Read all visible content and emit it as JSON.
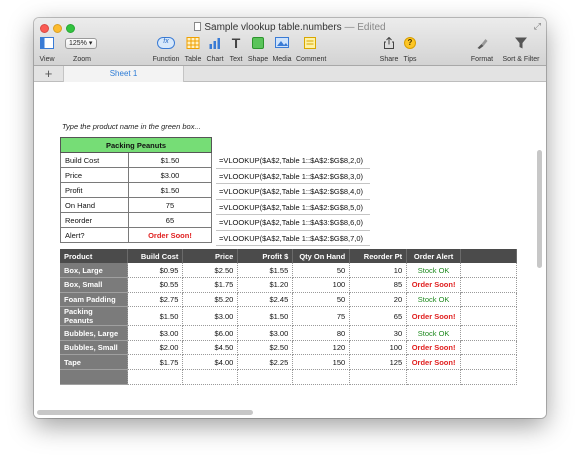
{
  "window": {
    "title": "Sample vlookup table.numbers",
    "status": "— Edited"
  },
  "toolbar": {
    "zoom_value": "125%",
    "items": [
      {
        "label": "View",
        "icon": "view-icon"
      },
      {
        "label": "Zoom",
        "icon": "zoom-select"
      },
      {
        "label": "Function",
        "icon": "function-icon"
      },
      {
        "label": "Table",
        "icon": "table-icon"
      },
      {
        "label": "Chart",
        "icon": "chart-icon"
      },
      {
        "label": "Text",
        "icon": "text-icon"
      },
      {
        "label": "Shape",
        "icon": "shape-icon"
      },
      {
        "label": "Media",
        "icon": "media-icon"
      },
      {
        "label": "Comment",
        "icon": "comment-icon"
      },
      {
        "label": "Share",
        "icon": "share-icon"
      },
      {
        "label": "Tips",
        "icon": "tips-icon"
      },
      {
        "label": "Format",
        "icon": "format-icon"
      },
      {
        "label": "Sort & Filter",
        "icon": "sort-filter-icon"
      }
    ],
    "function_glyph": "fx",
    "tips_glyph": "?",
    "text_glyph": "T"
  },
  "sheets": {
    "add_glyph": "+",
    "active": "Sheet 1"
  },
  "instruction": "Type the product name in the green box...",
  "lookup_table": {
    "header": "Packing Peanuts",
    "rows": [
      {
        "label": "Build Cost",
        "value": "$1.50",
        "formula": "=VLOOKUP($A$2,Table 1::$A$2:$G$8,2,0)"
      },
      {
        "label": "Price",
        "value": "$3.00",
        "formula": "=VLOOKUP($A$2,Table 1::$A$2:$G$8,3,0)"
      },
      {
        "label": "Profit",
        "value": "$1.50",
        "formula": "=VLOOKUP($A$2,Table 1::$A$2:$G$8,4,0)"
      },
      {
        "label": "On Hand",
        "value": "75",
        "formula": "=VLOOKUP($A$2,Table 1::$A$2:$G$8,5,0)"
      },
      {
        "label": "Reorder",
        "value": "65",
        "formula": "=VLOOKUP($A$2,Table 1::$A$3:$G$8,6,0)"
      },
      {
        "label": "Alert?",
        "value": "Order Soon!",
        "formula": "=VLOOKUP($A$2,Table 1::$A$2:$G$8,7,0)"
      }
    ]
  },
  "products_table": {
    "headers": [
      "Product",
      "Build Cost",
      "Price",
      "Profit $",
      "Qty On Hand",
      "Reorder Pt",
      "Order Alert"
    ],
    "rows": [
      {
        "product": "Box, Large",
        "build": "$0.95",
        "price": "$2.50",
        "profit": "$1.55",
        "qty": "50",
        "reorder": "10",
        "alert": "Stock OK"
      },
      {
        "product": "Box, Small",
        "build": "$0.55",
        "price": "$1.75",
        "profit": "$1.20",
        "qty": "100",
        "reorder": "85",
        "alert": "Order Soon!"
      },
      {
        "product": "Foam Padding",
        "build": "$2.75",
        "price": "$5.20",
        "profit": "$2.45",
        "qty": "50",
        "reorder": "20",
        "alert": "Stock OK"
      },
      {
        "product": "Packing Peanuts",
        "build": "$1.50",
        "price": "$3.00",
        "profit": "$1.50",
        "qty": "75",
        "reorder": "65",
        "alert": "Order Soon!"
      },
      {
        "product": "Bubbles, Large",
        "build": "$3.00",
        "price": "$6.00",
        "profit": "$3.00",
        "qty": "80",
        "reorder": "30",
        "alert": "Stock OK"
      },
      {
        "product": "Bubbles, Small",
        "build": "$2.00",
        "price": "$4.50",
        "profit": "$2.50",
        "qty": "120",
        "reorder": "100",
        "alert": "Order Soon!"
      },
      {
        "product": "Tape",
        "build": "$1.75",
        "price": "$4.00",
        "profit": "$2.25",
        "qty": "150",
        "reorder": "125",
        "alert": "Order Soon!"
      }
    ]
  },
  "colors": {
    "green_header": "#76dd76",
    "alert_red": "#e02020",
    "stock_ok_green": "#1f8a1f",
    "table_header_dark": "#4b4b4b",
    "sheet_tab_blue": "#2d7cd6"
  }
}
